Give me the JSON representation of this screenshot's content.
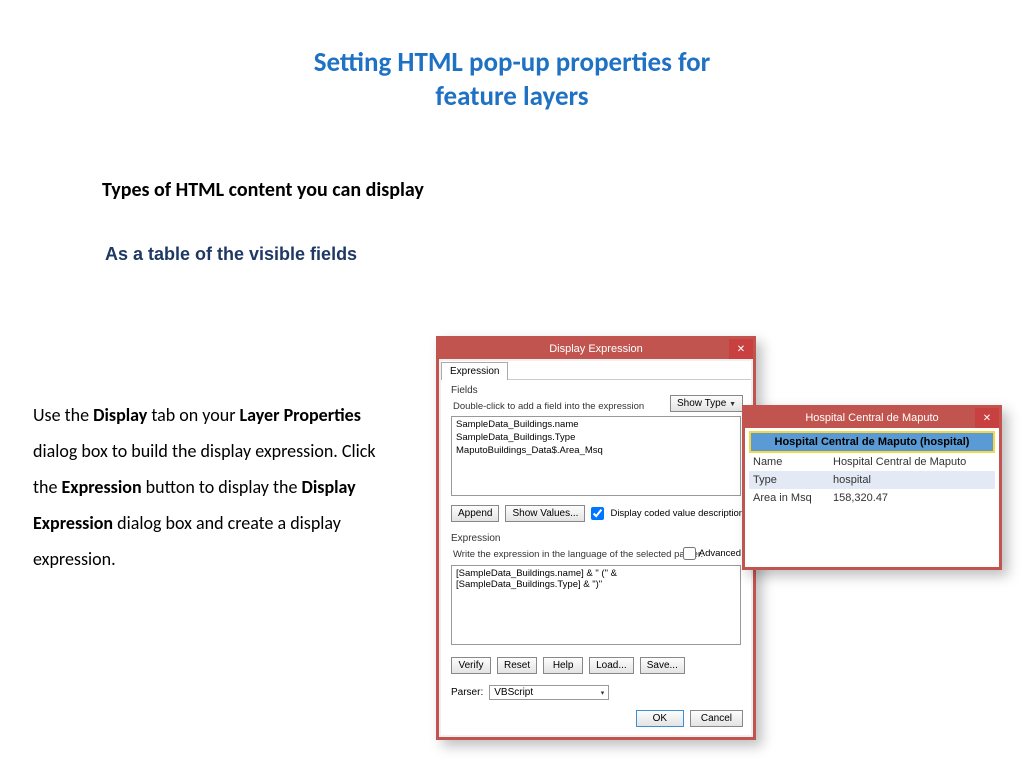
{
  "slide": {
    "title_line1": "Setting HTML pop-up properties for",
    "title_line2": "feature layers",
    "subheading1": "Types of HTML content you can display",
    "subheading2": "As a table of the visible fields",
    "body": {
      "p1a": "Use the ",
      "p1b": "Display",
      "p1c": " tab on your ",
      "p1d": "Layer Properties",
      "p1e": " dialog box to build the display expression. Click the ",
      "p1f": "Expression",
      "p1g": " button to display the ",
      "p1h": "Display Expression",
      "p1i": " dialog box and create a display expression."
    }
  },
  "dlg1": {
    "title": "Display Expression",
    "close": "✕",
    "tab": "Expression",
    "fields_label": "Fields",
    "hint": "Double-click to add a field into the expression",
    "show_type": "Show Type",
    "fields": {
      "f1": "SampleData_Buildings.name",
      "f2": "SampleData_Buildings.Type",
      "f3": "MaputoBuildings_Data$.Area_Msq"
    },
    "append": "Append",
    "show_values": "Show Values...",
    "coded_check": "Display coded value description",
    "exp_label": "Expression",
    "exp_hint": "Write the expression in the language of the selected parser.",
    "advanced": "Advanced",
    "exp_text": "[SampleData_Buildings.name]  & \" (\" & [SampleData_Buildings.Type] & \")\"",
    "verify": "Verify",
    "reset": "Reset",
    "help": "Help",
    "load": "Load...",
    "save": "Save...",
    "parser_label": "Parser:",
    "parser_value": "VBScript",
    "ok": "OK",
    "cancel": "Cancel"
  },
  "dlg2": {
    "title": "Hospital Central de Maputo",
    "close": "✕",
    "header": "Hospital Central de Maputo (hospital)",
    "rows": {
      "r1k": "Name",
      "r1v": "Hospital Central de Maputo",
      "r2k": "Type",
      "r2v": "hospital",
      "r3k": "Area in Msq",
      "r3v": "158,320.47"
    }
  }
}
